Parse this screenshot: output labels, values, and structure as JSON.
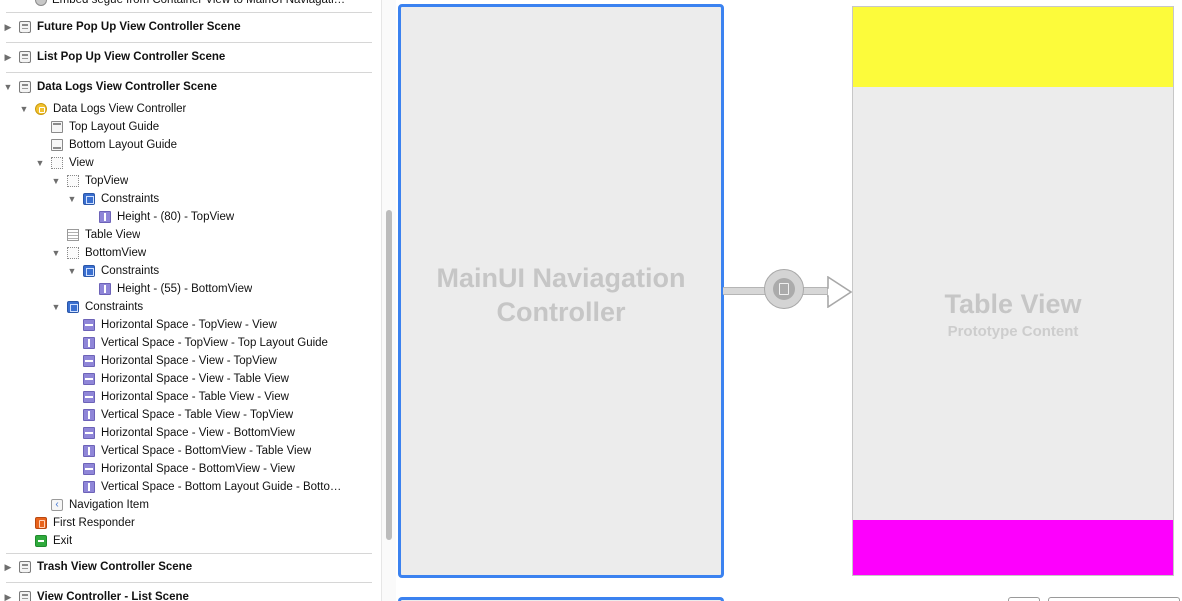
{
  "outline": {
    "items": [
      {
        "label": "Embed segue from Container View to MainUI Naviagati…",
        "icon": "segue-icon",
        "expanded": null
      },
      {
        "label": "Future Pop Up View Controller Scene",
        "icon": "scene-icon",
        "expanded": false
      },
      {
        "label": "List Pop Up View Controller Scene",
        "icon": "scene-icon",
        "expanded": false
      },
      {
        "label": "Data Logs View Controller Scene",
        "icon": "scene-icon",
        "expanded": true
      },
      {
        "label": "Data Logs View Controller",
        "icon": "view-controller-icon",
        "expanded": true
      },
      {
        "label": "Top Layout Guide",
        "icon": "layout-guide-icon",
        "expanded": null
      },
      {
        "label": "Bottom Layout Guide",
        "icon": "layout-guide-icon",
        "expanded": null
      },
      {
        "label": "View",
        "icon": "view-icon",
        "expanded": true
      },
      {
        "label": "TopView",
        "icon": "view-icon",
        "expanded": true
      },
      {
        "label": "Constraints",
        "icon": "constraints-icon",
        "expanded": true
      },
      {
        "label": "Height - (80) - TopView",
        "icon": "constraint-icon",
        "expanded": null
      },
      {
        "label": "Table View",
        "icon": "table-view-icon",
        "expanded": null
      },
      {
        "label": "BottomView",
        "icon": "view-icon",
        "expanded": true
      },
      {
        "label": "Constraints",
        "icon": "constraints-icon",
        "expanded": true
      },
      {
        "label": "Height - (55) - BottomView",
        "icon": "constraint-icon",
        "expanded": null
      },
      {
        "label": "Constraints",
        "icon": "constraints-icon",
        "expanded": true
      },
      {
        "label": "Horizontal Space - TopView - View",
        "icon": "constraint-icon",
        "expanded": null
      },
      {
        "label": "Vertical Space - TopView - Top Layout Guide",
        "icon": "constraint-icon",
        "expanded": null
      },
      {
        "label": "Horizontal Space - View - TopView",
        "icon": "constraint-icon",
        "expanded": null
      },
      {
        "label": "Horizontal Space - View - Table View",
        "icon": "constraint-icon",
        "expanded": null
      },
      {
        "label": "Horizontal Space - Table View - View",
        "icon": "constraint-icon",
        "expanded": null
      },
      {
        "label": "Vertical Space - Table View - TopView",
        "icon": "constraint-icon",
        "expanded": null
      },
      {
        "label": "Horizontal Space - View - BottomView",
        "icon": "constraint-icon",
        "expanded": null
      },
      {
        "label": "Vertical Space - BottomView - Table View",
        "icon": "constraint-icon",
        "expanded": null
      },
      {
        "label": "Horizontal Space - BottomView - View",
        "icon": "constraint-icon",
        "expanded": null
      },
      {
        "label": "Vertical Space - Bottom Layout Guide - Botto…",
        "icon": "constraint-icon",
        "expanded": null
      },
      {
        "label": "Navigation Item",
        "icon": "navigation-item-icon",
        "expanded": null
      },
      {
        "label": "First Responder",
        "icon": "first-responder-icon",
        "expanded": null
      },
      {
        "label": "Exit",
        "icon": "exit-icon",
        "expanded": null
      },
      {
        "label": "Trash View Controller Scene",
        "icon": "scene-icon",
        "expanded": false
      },
      {
        "label": "View Controller - List Scene",
        "icon": "scene-icon",
        "expanded": false
      }
    ]
  },
  "canvas": {
    "nav_controller_title": "MainUI Naviagation Controller",
    "table_view_title": "Table View",
    "table_view_subtitle": "Prototype Content",
    "colors": {
      "selection_border": "#3b82f0",
      "top_view": "#fcfb3b",
      "bottom_view": "#fd00fd",
      "scene_background": "#ececec"
    }
  }
}
